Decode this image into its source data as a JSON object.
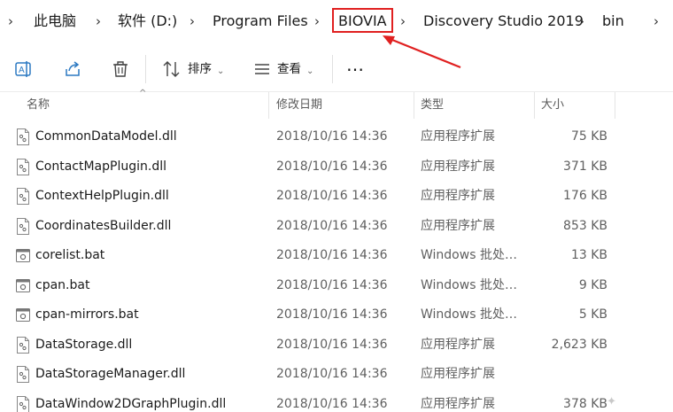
{
  "breadcrumb": {
    "items": [
      "此电脑",
      "软件 (D:)",
      "Program Files",
      "BIOVIA",
      "Discovery Studio 2019",
      "bin"
    ],
    "highlighted": "BIOVIA",
    "highlight_color": "#e02020"
  },
  "toolbar": {
    "sort_label": "排序",
    "view_label": "查看",
    "more_label": "…",
    "icons": [
      "rename-icon",
      "share-icon",
      "delete-icon",
      "sort-icon",
      "view-icon",
      "more-icon"
    ]
  },
  "columns": {
    "name": "名称",
    "date": "修改日期",
    "type": "类型",
    "size": "大小"
  },
  "files": [
    {
      "name": "CommonDataModel.dll",
      "date": "2018/10/16 14:36",
      "type": "应用程序扩展",
      "size": "75 KB",
      "icon": "dll-file-icon"
    },
    {
      "name": "ContactMapPlugin.dll",
      "date": "2018/10/16 14:36",
      "type": "应用程序扩展",
      "size": "371 KB",
      "icon": "dll-file-icon"
    },
    {
      "name": "ContextHelpPlugin.dll",
      "date": "2018/10/16 14:36",
      "type": "应用程序扩展",
      "size": "176 KB",
      "icon": "dll-file-icon"
    },
    {
      "name": "CoordinatesBuilder.dll",
      "date": "2018/10/16 14:36",
      "type": "应用程序扩展",
      "size": "853 KB",
      "icon": "dll-file-icon"
    },
    {
      "name": "corelist.bat",
      "date": "2018/10/16 14:36",
      "type": "Windows 批处理...",
      "size": "13 KB",
      "icon": "bat-file-icon"
    },
    {
      "name": "cpan.bat",
      "date": "2018/10/16 14:36",
      "type": "Windows 批处理...",
      "size": "9 KB",
      "icon": "bat-file-icon"
    },
    {
      "name": "cpan-mirrors.bat",
      "date": "2018/10/16 14:36",
      "type": "Windows 批处理...",
      "size": "5 KB",
      "icon": "bat-file-icon"
    },
    {
      "name": "DataStorage.dll",
      "date": "2018/10/16 14:36",
      "type": "应用程序扩展",
      "size": "2,623 KB",
      "icon": "dll-file-icon"
    },
    {
      "name": "DataStorageManager.dll",
      "date": "2018/10/16 14:36",
      "type": "应用程序扩展",
      "size": "",
      "icon": "dll-file-icon"
    },
    {
      "name": "DataWindow2DGraphPlugin.dll",
      "date": "2018/10/16 14:36",
      "type": "应用程序扩展",
      "size": "378 KB",
      "icon": "dll-file-icon"
    }
  ]
}
